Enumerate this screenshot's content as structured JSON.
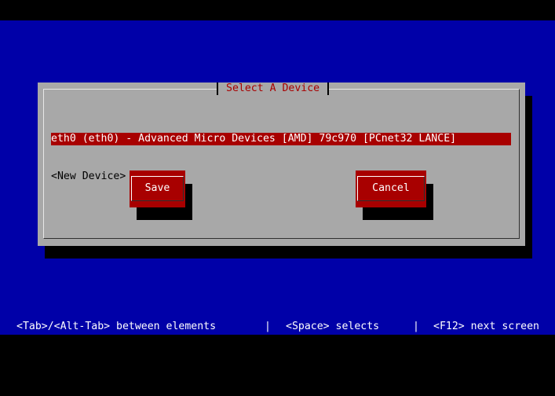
{
  "dialog": {
    "title": "Select A Device",
    "devices": [
      "eth0 (eth0) - Advanced Micro Devices [AMD] 79c970 [PCnet32 LANCE]",
      "<New Device>"
    ],
    "save_label": "Save",
    "cancel_label": "Cancel"
  },
  "statusbar": {
    "hint_tab": "<Tab>/<Alt-Tab> between elements",
    "separator": "|",
    "hint_space": "<Space> selects",
    "hint_f12": "<F12> next screen"
  },
  "colors": {
    "background": "#0000a8",
    "dialog": "#a8a8a8",
    "accent": "#a80000"
  }
}
